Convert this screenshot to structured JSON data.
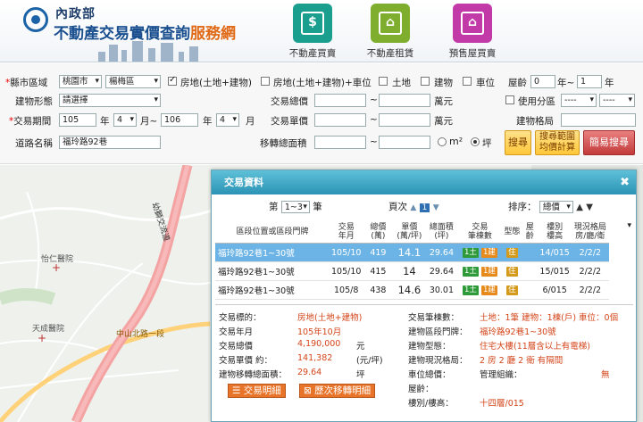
{
  "header": {
    "ministry": "內政部",
    "title_main": "不動產交易實價查詢",
    "title_accent": "服務網",
    "nav": [
      {
        "label": "不動產買賣",
        "glyph": "$",
        "color": "#1a9f8f"
      },
      {
        "label": "不動產租賃",
        "glyph": "⌂",
        "color": "#7fae2f"
      },
      {
        "label": "預售屋買賣",
        "glyph": "⌂",
        "color": "#c23aa8"
      }
    ]
  },
  "form": {
    "county_label": "縣市區域",
    "county_value": "桃園市",
    "district_value": "楊梅區",
    "type_land_building": "房地(土地+建物)",
    "type_land_building_parking": "房地(土地+建物)+車位",
    "type_land": "土地",
    "type_building": "建物",
    "type_parking": "車位",
    "age_label": "屋齡",
    "age_from": "0",
    "age_sep": "年~",
    "age_to": "1",
    "age_unit": "年",
    "building_form_label": "建物形態",
    "building_form_value": "請選擇",
    "total_price_label": "交易總價",
    "unit_wan": "萬元",
    "use_zone_label": "使用分區",
    "use_zone_a": "----",
    "use_zone_b": "----",
    "period_label": "交易期間",
    "period_from_year": "105",
    "period_from_month": "4",
    "period_to_year": "106",
    "period_to_month": "4",
    "year_unit": "年",
    "month_unit": "月",
    "month_sep": "月~",
    "unit_price_label": "交易單價",
    "layout_label": "建物格局",
    "road_label": "道路名稱",
    "road_value": "福玲路92巷",
    "area_label": "移轉總面積",
    "tilde": "~",
    "unit_m2": "m²",
    "unit_ping": "坪",
    "search_btn": "搜尋",
    "range_search_btn_1": "搜尋範圍",
    "range_search_btn_2": "均價計算",
    "simple_search_btn": "簡易搜尋"
  },
  "map": {
    "labels": [
      "怡仁醫院",
      "天成醫院",
      "幼獅交流道",
      "中山北路一段"
    ]
  },
  "panel": {
    "title": "交易資料",
    "close": "✖",
    "range_prefix": "第",
    "range_value": "1~3",
    "range_suffix": "筆",
    "page_label": "頁次",
    "page_value": "1",
    "sort_label": "排序：",
    "sort_value": "總價",
    "headers": [
      "區段位置或區段門牌",
      "交易\n年月",
      "總價\n(萬)",
      "單價\n(萬/坪)",
      "總面積\n(坪)",
      "交易\n筆棟數",
      "型態",
      "屋齡",
      "樓別\n樓高",
      "現況格局\n房/廳/衛"
    ],
    "rows": [
      {
        "addr": "福玲路92巷1~30號",
        "date": "105/10",
        "total": "419",
        "unit": "14.1",
        "area": "29.64",
        "land": "1土",
        "bldg": "1建",
        "type": "住",
        "age": "",
        "floor": "14/015",
        "layout": "2/2/2"
      },
      {
        "addr": "福玲路92巷1~30號",
        "date": "105/10",
        "total": "415",
        "unit": "14",
        "area": "29.64",
        "land": "1土",
        "bldg": "1建",
        "type": "住",
        "age": "",
        "floor": "15/015",
        "layout": "2/2/2"
      },
      {
        "addr": "福玲路92巷1~30號",
        "date": "105/8",
        "total": "438",
        "unit": "14.6",
        "area": "30.01",
        "land": "1土",
        "bldg": "1建",
        "type": "住",
        "age": "",
        "floor": "6/015",
        "layout": "2/2/2"
      }
    ],
    "detail": {
      "target_label": "交易標的：",
      "target_value": "房地(土地+建物)",
      "date_label": "交易年月",
      "date_value": "105年10月",
      "total_label": "交易總價",
      "total_value": "4,190,000",
      "total_unit": "元",
      "unit_label": "交易單價 約：",
      "unit_value": "141,382",
      "unit_unit": "(元/坪)",
      "area_label": "建物移轉總面積：",
      "area_value": "29.64",
      "area_unit": "坪",
      "count_label": "交易筆棟數：",
      "count_value": "土地：1筆 建物：1棟(戶) 車位：0個",
      "addr_label": "建物區段門牌：",
      "addr_value": "福玲路92巷1~30號",
      "type_label": "建物型態：",
      "type_value": "住宅大樓(11層含以上有電梯)",
      "layout_label": "建物現況格局：",
      "layout_value": "2 房 2 廳 2 衛 有隔間",
      "parking_label": "車位總價：",
      "mgmt_label": "管理組織：",
      "mgmt_value": "無",
      "age_label": "屋齡：",
      "floor_label": "樓別/樓高：",
      "floor_value": "十四層/015",
      "detail_btn": "交易明細",
      "history_btn": "歷次移轉明細"
    }
  }
}
